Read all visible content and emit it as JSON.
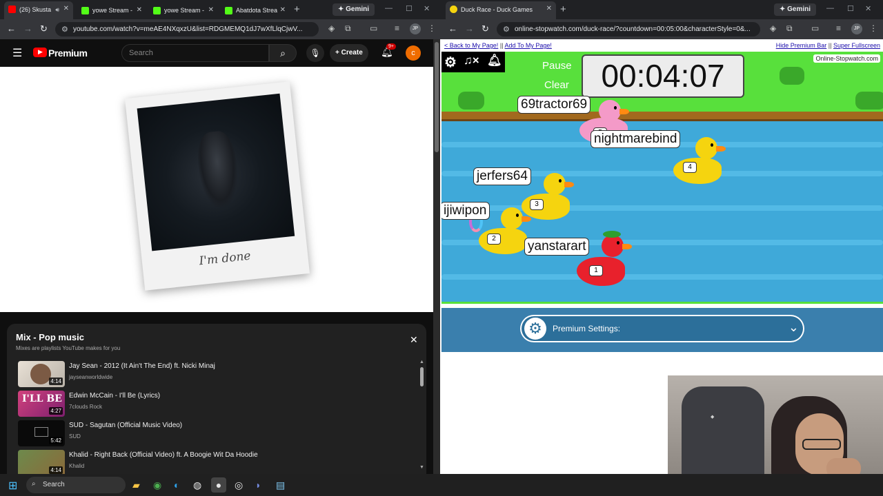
{
  "left_window": {
    "tabs": [
      {
        "label": "(26) Skusta",
        "active": true
      },
      {
        "label": "yowe Stream - ",
        "active": false
      },
      {
        "label": "yowe Stream - ",
        "active": false
      },
      {
        "label": "Abatdota Strea",
        "active": false
      }
    ],
    "gemini": "✦ Gemini",
    "url": "youtube.com/watch?v=meAE4NXqxzU&list=RDGMEMQ1dJ7wXfLlqCjwV...",
    "profile": "JP",
    "youtube": {
      "logo": "Premium",
      "search_placeholder": "Search",
      "create_label": "Create",
      "notif_count": "9+",
      "avatar_letter": "c",
      "caption": "I'm done",
      "mix": {
        "title": "Mix - Pop music",
        "subtitle": "Mixes are playlists YouTube makes for you",
        "items": [
          {
            "title": "Jay Sean - 2012 (It Ain't The End) ft. Nicki Minaj",
            "artist": "jayseanworldwide",
            "duration": "4:14"
          },
          {
            "title": "Edwin McCain - I'll Be (Lyrics)",
            "artist": "7clouds Rock",
            "duration": "4:27",
            "thumb_text": "I'LL BE"
          },
          {
            "title": "SUD - Sagutan (Official Music Video)",
            "artist": "SUD",
            "duration": "5:42"
          },
          {
            "title": "Khalid - Right Back (Official Video) ft. A Boogie Wit Da Hoodie",
            "artist": "Khalid",
            "duration": "4:14"
          }
        ]
      }
    }
  },
  "right_window": {
    "tabs": [
      {
        "label": "Duck Race - Duck Games",
        "active": true
      }
    ],
    "gemini": "✦ Gemini",
    "url": "online-stopwatch.com/duck-race/?countdown=00:05:00&characterStyle=0&...",
    "profile": "JP",
    "page": {
      "link_back": "< Back to My Page!",
      "link_add": "Add To My Page!",
      "link_hide": "Hide Premium Bar",
      "link_fullscreen": "Super Fullscreen",
      "pause": "Pause",
      "clear": "Clear",
      "timer": "00:04:07",
      "site_logo": "Online-Stopwatch.com",
      "racers": [
        {
          "name": "69tractor69",
          "number": "5"
        },
        {
          "name": "nightmarebind",
          "number": "4"
        },
        {
          "name": "jerfers64",
          "number": "3"
        },
        {
          "name": "ijiwipon",
          "number": "2"
        },
        {
          "name": "yanstarart",
          "number": "1"
        }
      ],
      "premium_settings": "Premium Settings:"
    }
  },
  "taskbar": {
    "search": "Search"
  },
  "colors": {
    "yt_red": "#ff0000",
    "grass": "#58e03c",
    "water": "#3fa9d9",
    "settings_blue": "#2c6f9a"
  }
}
